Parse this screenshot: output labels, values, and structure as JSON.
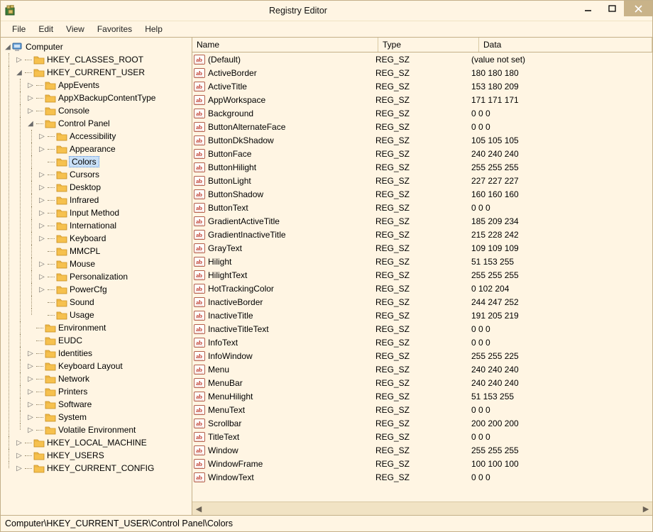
{
  "window": {
    "title": "Registry Editor"
  },
  "menu": [
    "File",
    "Edit",
    "View",
    "Favorites",
    "Help"
  ],
  "status_path": "Computer\\HKEY_CURRENT_USER\\Control Panel\\Colors",
  "tree": {
    "root": "Computer",
    "hives": [
      "HKEY_CLASSES_ROOT",
      "HKEY_CURRENT_USER",
      "HKEY_LOCAL_MACHINE",
      "HKEY_USERS",
      "HKEY_CURRENT_CONFIG"
    ],
    "hkcu_children": [
      "AppEvents",
      "AppXBackupContentType",
      "Console",
      "Control Panel",
      "Environment",
      "EUDC",
      "Identities",
      "Keyboard Layout",
      "Network",
      "Printers",
      "Software",
      "System",
      "Volatile Environment"
    ],
    "control_panel_children": [
      "Accessibility",
      "Appearance",
      "Colors",
      "Cursors",
      "Desktop",
      "Infrared",
      "Input Method",
      "International",
      "Keyboard",
      "MMCPL",
      "Mouse",
      "Personalization",
      "PowerCfg",
      "Sound",
      "Usage"
    ],
    "selected": "Colors",
    "leafs_no_expand": [
      "Colors",
      "MMCPL",
      "Sound",
      "Usage",
      "Environment",
      "EUDC"
    ]
  },
  "columns": {
    "name": "Name",
    "type": "Type",
    "data": "Data"
  },
  "values": [
    {
      "name": "(Default)",
      "type": "REG_SZ",
      "data": "(value not set)"
    },
    {
      "name": "ActiveBorder",
      "type": "REG_SZ",
      "data": "180 180 180"
    },
    {
      "name": "ActiveTitle",
      "type": "REG_SZ",
      "data": "153 180 209"
    },
    {
      "name": "AppWorkspace",
      "type": "REG_SZ",
      "data": "171 171 171"
    },
    {
      "name": "Background",
      "type": "REG_SZ",
      "data": "0 0 0"
    },
    {
      "name": "ButtonAlternateFace",
      "type": "REG_SZ",
      "data": "0 0 0"
    },
    {
      "name": "ButtonDkShadow",
      "type": "REG_SZ",
      "data": "105 105 105"
    },
    {
      "name": "ButtonFace",
      "type": "REG_SZ",
      "data": "240 240 240"
    },
    {
      "name": "ButtonHilight",
      "type": "REG_SZ",
      "data": "255 255 255"
    },
    {
      "name": "ButtonLight",
      "type": "REG_SZ",
      "data": "227 227 227"
    },
    {
      "name": "ButtonShadow",
      "type": "REG_SZ",
      "data": "160 160 160"
    },
    {
      "name": "ButtonText",
      "type": "REG_SZ",
      "data": "0 0 0"
    },
    {
      "name": "GradientActiveTitle",
      "type": "REG_SZ",
      "data": "185 209 234"
    },
    {
      "name": "GradientInactiveTitle",
      "type": "REG_SZ",
      "data": "215 228 242"
    },
    {
      "name": "GrayText",
      "type": "REG_SZ",
      "data": "109 109 109"
    },
    {
      "name": "Hilight",
      "type": "REG_SZ",
      "data": "51 153 255"
    },
    {
      "name": "HilightText",
      "type": "REG_SZ",
      "data": "255 255 255"
    },
    {
      "name": "HotTrackingColor",
      "type": "REG_SZ",
      "data": "0 102 204"
    },
    {
      "name": "InactiveBorder",
      "type": "REG_SZ",
      "data": "244 247 252"
    },
    {
      "name": "InactiveTitle",
      "type": "REG_SZ",
      "data": "191 205 219"
    },
    {
      "name": "InactiveTitleText",
      "type": "REG_SZ",
      "data": "0 0 0"
    },
    {
      "name": "InfoText",
      "type": "REG_SZ",
      "data": "0 0 0"
    },
    {
      "name": "InfoWindow",
      "type": "REG_SZ",
      "data": "255 255 225"
    },
    {
      "name": "Menu",
      "type": "REG_SZ",
      "data": "240 240 240"
    },
    {
      "name": "MenuBar",
      "type": "REG_SZ",
      "data": "240 240 240"
    },
    {
      "name": "MenuHilight",
      "type": "REG_SZ",
      "data": "51 153 255"
    },
    {
      "name": "MenuText",
      "type": "REG_SZ",
      "data": "0 0 0"
    },
    {
      "name": "Scrollbar",
      "type": "REG_SZ",
      "data": "200 200 200"
    },
    {
      "name": "TitleText",
      "type": "REG_SZ",
      "data": "0 0 0"
    },
    {
      "name": "Window",
      "type": "REG_SZ",
      "data": "255 255 255"
    },
    {
      "name": "WindowFrame",
      "type": "REG_SZ",
      "data": "100 100 100"
    },
    {
      "name": "WindowText",
      "type": "REG_SZ",
      "data": "0 0 0"
    }
  ]
}
